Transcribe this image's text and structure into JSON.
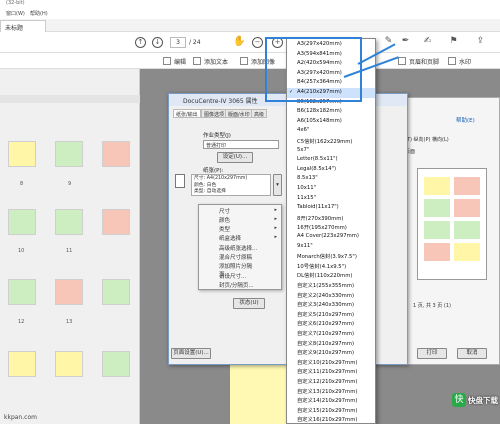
{
  "app": {
    "title_fragment": "(32-bit)",
    "menu": [
      "窗口(W)",
      "帮助(H)"
    ],
    "tab": "未标题"
  },
  "toolbar": {
    "page_current": "3",
    "page_total": "/ 24"
  },
  "toolbar2": {
    "edit": "编辑",
    "add_text": "添加文本",
    "add_image": "添加图像",
    "page_header": "页眉和页脚",
    "watermark": "水印"
  },
  "thumbs": {
    "numbers": [
      "8",
      "9",
      "10",
      "11",
      "12",
      "13"
    ]
  },
  "dialog": {
    "title": "DocuCentre-IV 3065 属性",
    "tabs": [
      "纸张/输出",
      "图像选项",
      "版面/水印",
      "高级"
    ],
    "job_type_label": "作业类型(J)",
    "job_type_value": "普通打印",
    "setup_button": "设定(U)...",
    "paper_label": "纸张(P):",
    "paper_summary": [
      "尺寸: A4(210x297mm)",
      "颜色: 白色",
      "类型: 自动选择"
    ],
    "status_button": "状态(U)",
    "page_setup_button": "页面设置(U)..."
  },
  "context_menu": [
    "尺寸",
    "颜色",
    "类型",
    "纸盒选择",
    "高级纸张选择...",
    "混合尺寸原稿",
    "添加照片分隔页...",
    "请设尺寸...",
    "封页/分隔页..."
  ],
  "printpanel": {
    "help": "帮助(E)",
    "orient": "(T) 纵向(P) 横向(L)",
    "header_label": "页面",
    "pages_info": "1 页, 共 3 页 (1)",
    "print_button": "打印",
    "cancel_button": "取消"
  },
  "dropdown": {
    "items": [
      "A3(297x420mm)",
      "A3(594x841mm)",
      "A2(420x594mm)",
      "A3(297x420mm)",
      "B4(257x364mm)",
      "A4(210x297mm)",
      "B5(182x257mm)",
      "B6(128x182mm)",
      "A6(105x148mm)",
      "4x6\"",
      "C5信封(162x229mm)",
      "5x7\"",
      "Letter(8.5x11\")",
      "Legal(8.5x14\")",
      "8.5x13\"",
      "10x11\"",
      "11x15\"",
      "Tabloid(11x17\")",
      "8开(270x390mm)",
      "16开(195x270mm)",
      "A4 Cover(223x297mm)",
      "9x11\"",
      "Monarch信封(3.9x7.5\")",
      "10号信封(4.1x9.5\")",
      "DL信封(110x220mm)",
      "自定义1(255x355mm)",
      "自定义2(240x330mm)",
      "自定义3(240x330mm)",
      "自定义5(210x297mm)",
      "自定义6(210x297mm)",
      "自定义7(210x297mm)",
      "自定义8(210x297mm)",
      "自定义9(210x297mm)",
      "自定义10(210x297mm)",
      "自定义11(210x297mm)",
      "自定义12(210x297mm)",
      "自定义13(210x297mm)",
      "自定义14(210x297mm)",
      "自定义15(210x297mm)",
      "自定义16(210x297mm)"
    ],
    "selected": "A4(210x297mm)"
  },
  "watermark": {
    "text": "快盘下载",
    "url": "kkpan.com"
  },
  "colors": {
    "highlight": "#2f82d8",
    "thumb_yellow": "#fff6a8",
    "thumb_green": "#cdeec0",
    "thumb_pink": "#f8c6b8",
    "select": "#cfe2fb"
  }
}
